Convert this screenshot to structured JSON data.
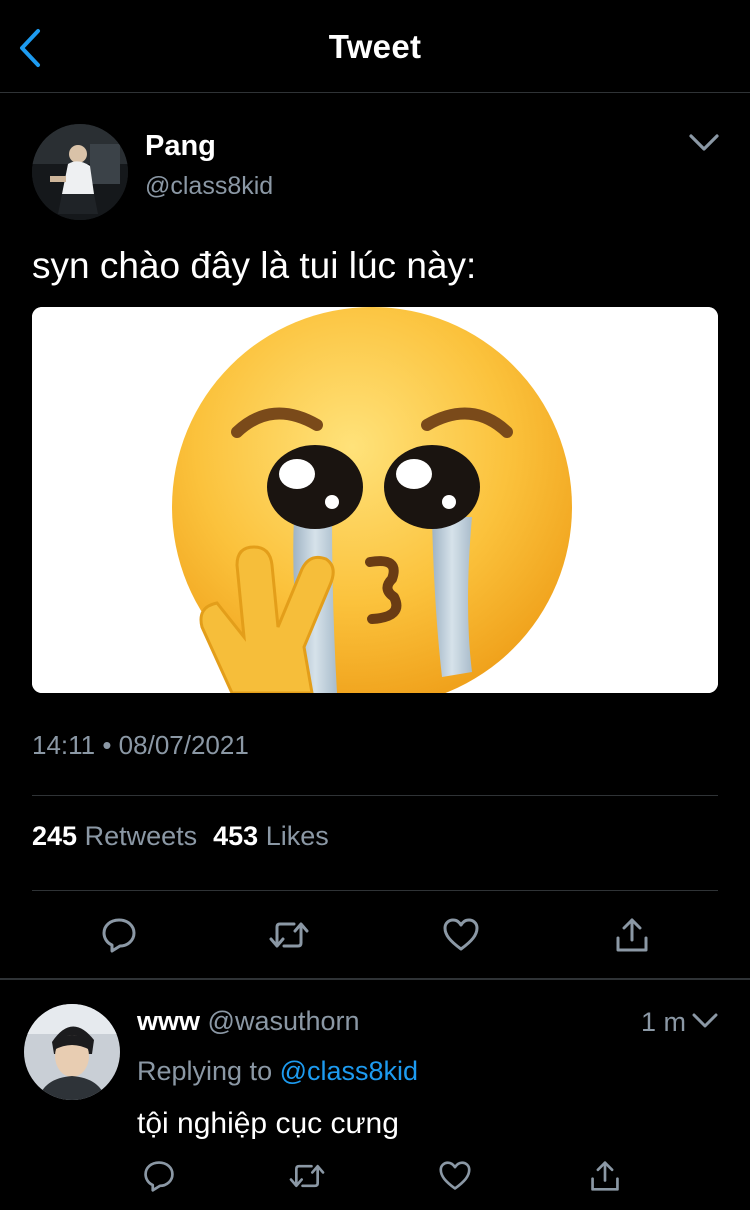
{
  "topbar": {
    "title": "Tweet",
    "back_icon": "chevron-left-icon"
  },
  "tweet": {
    "author_name": "Pang",
    "author_handle": "@class8kid",
    "text": "syn chào đây là tui lúc này:",
    "media_alt": "pleading-face-with-tears-peace-sign-emoji",
    "timestamp": "14:11 • 08/07/2021",
    "retweets_count": "245",
    "retweets_label": "Retweets",
    "likes_count": "453",
    "likes_label": "Likes",
    "actions": [
      "reply-icon",
      "retweet-icon",
      "like-icon",
      "share-icon"
    ]
  },
  "reply": {
    "author_name": "www",
    "author_handle": "@wasuthorn",
    "time": "1 m",
    "replying_prefix": "Replying to",
    "replying_handle": "@class8kid",
    "text": "tội nghiệp cục cưng"
  },
  "colors": {
    "background": "#000000",
    "accent": "#1d9bf0",
    "secondary_text": "#8b98a5",
    "divider": "#2f3336"
  }
}
